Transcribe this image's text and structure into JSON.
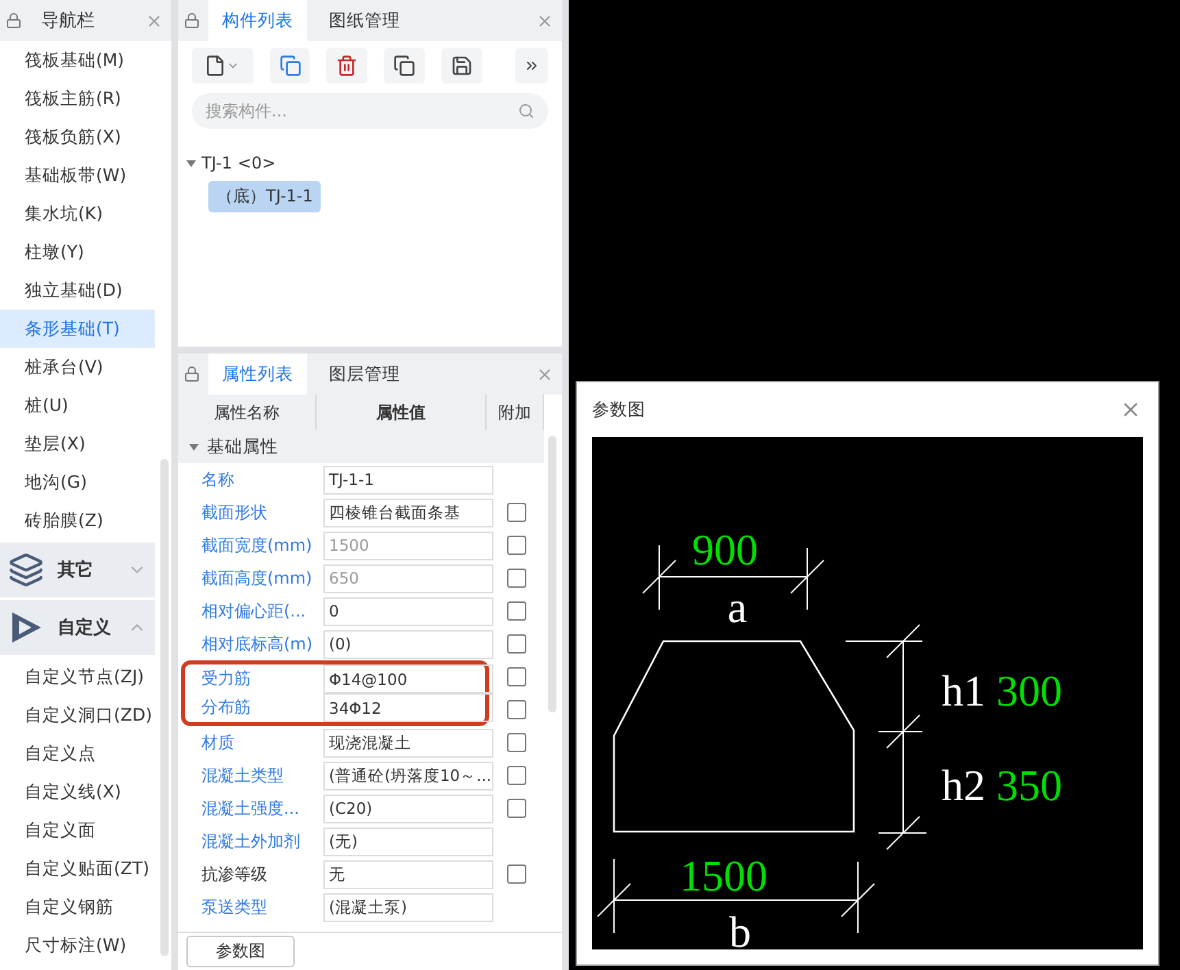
{
  "nav": {
    "title": "导航栏",
    "items": [
      {
        "label": "筏板基础(M)",
        "selected": false
      },
      {
        "label": "筏板主筋(R)",
        "selected": false
      },
      {
        "label": "筏板负筋(X)",
        "selected": false
      },
      {
        "label": "基础板带(W)",
        "selected": false
      },
      {
        "label": "集水坑(K)",
        "selected": false
      },
      {
        "label": "柱墩(Y)",
        "selected": false
      },
      {
        "label": "独立基础(D)",
        "selected": false
      },
      {
        "label": "条形基础(T)",
        "selected": true
      },
      {
        "label": "桩承台(V)",
        "selected": false
      },
      {
        "label": "桩(U)",
        "selected": false
      },
      {
        "label": "垫层(X)",
        "selected": false
      },
      {
        "label": "地沟(G)",
        "selected": false
      },
      {
        "label": "砖胎膜(Z)",
        "selected": false
      }
    ],
    "groups": [
      {
        "title": "其它",
        "kind": "layers",
        "expanded": false
      },
      {
        "title": "自定义",
        "kind": "custom",
        "expanded": true,
        "items": [
          {
            "label": "自定义节点(ZJ)",
            "selected": false
          },
          {
            "label": "自定义洞口(ZD)",
            "selected": false
          },
          {
            "label": "自定义点",
            "selected": false
          },
          {
            "label": "自定义线(X)",
            "selected": false
          },
          {
            "label": "自定义面",
            "selected": false
          },
          {
            "label": "自定义贴面(ZT)",
            "selected": false
          },
          {
            "label": "自定义钢筋",
            "selected": false
          },
          {
            "label": "尺寸标注(W)",
            "selected": false
          }
        ]
      }
    ]
  },
  "component_panel": {
    "tabs": [
      {
        "label": "构件列表",
        "selected": true
      },
      {
        "label": "图纸管理",
        "selected": false
      }
    ],
    "search": {
      "placeholder": "搜索构件..."
    },
    "tree": [
      {
        "label": "TJ-1",
        "count": "<0>",
        "expanded": true,
        "selected": false,
        "children": [
          {
            "label": "（底）TJ-1-1",
            "selected": true
          }
        ]
      }
    ]
  },
  "property_panel": {
    "tabs": [
      {
        "label": "属性列表",
        "selected": true
      },
      {
        "label": "图层管理",
        "selected": false
      }
    ],
    "columns": [
      "属性名称",
      "属性值",
      "附加"
    ],
    "group": {
      "label": "基础属性",
      "expanded": true
    },
    "rows": [
      {
        "name": "名称",
        "value": "TJ-1-1",
        "linked": true,
        "disabled": false,
        "highlighted": false
      },
      {
        "name": "截面形状",
        "value": "四棱锥台截面条基",
        "linked": true,
        "disabled": false,
        "checked": false,
        "highlighted": false
      },
      {
        "name": "截面宽度(mm)",
        "value": "1500",
        "linked": true,
        "disabled": true,
        "checked": false,
        "highlighted": false
      },
      {
        "name": "截面高度(mm)",
        "value": "650",
        "linked": true,
        "disabled": true,
        "checked": false,
        "highlighted": false
      },
      {
        "name": "相对偏心距(...",
        "value": "0",
        "linked": true,
        "disabled": false,
        "checked": false,
        "highlighted": false
      },
      {
        "name": "相对底标高(m)",
        "value": "(0)",
        "linked": true,
        "disabled": false,
        "checked": false,
        "highlighted": false
      },
      {
        "name": "受力筋",
        "value": "Φ14@100",
        "linked": true,
        "disabled": false,
        "checked": false,
        "highlighted": true
      },
      {
        "name": "分布筋",
        "value": "34Φ12",
        "linked": true,
        "disabled": false,
        "checked": false,
        "highlighted": true
      },
      {
        "name": "材质",
        "value": "现浇混凝土",
        "linked": true,
        "disabled": false,
        "checked": false,
        "highlighted": false
      },
      {
        "name": "混凝土类型",
        "value": "(普通砼(坍落度10～...",
        "linked": true,
        "disabled": false,
        "checked": false,
        "highlighted": false
      },
      {
        "name": "混凝土强度...",
        "value": "(C20)",
        "linked": true,
        "disabled": false,
        "checked": false,
        "highlighted": false
      },
      {
        "name": "混凝土外加剂",
        "value": "(无)",
        "linked": true,
        "disabled": false,
        "highlighted": false
      },
      {
        "name": "抗渗等级",
        "value": "无",
        "linked": false,
        "disabled": false,
        "checked": false,
        "highlighted": false
      },
      {
        "name": "泵送类型",
        "value": "(混凝土泵)",
        "linked": true,
        "disabled": false,
        "highlighted": false
      }
    ],
    "button": "参数图"
  },
  "dialog": {
    "title": "参数图",
    "diagram": {
      "top": {
        "value": "900",
        "label": "a"
      },
      "right": [
        {
          "label": "h1",
          "value": "300"
        },
        {
          "label": "h2",
          "value": "350"
        }
      ],
      "bottom": {
        "value": "1500",
        "label": "b"
      }
    }
  }
}
